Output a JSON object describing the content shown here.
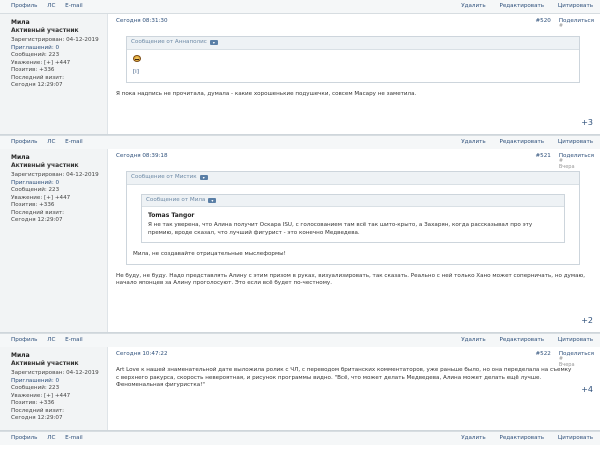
{
  "bar_top": {
    "left": [
      "Профиль",
      "ЛС",
      "E-mail"
    ],
    "right": [
      "Удалить",
      "Редактировать",
      "Цитировать"
    ]
  },
  "posts": [
    {
      "author": {
        "name": "Мила",
        "rank": "Активный участник",
        "registered": "Зарегистрирован: 04-12-2019",
        "invited": "Приглашений: 0",
        "messages": "Сообщений: 223",
        "respect": "Уважение: [+] +447",
        "positive": "Позитив: +336",
        "last_visit_label": "Последний визит:",
        "last_visit": "Сегодня 12:29:07"
      },
      "date": "Сегодня 08:31:30",
      "num": "#520",
      "share": "Поделиться",
      "share_sub": "#",
      "quote": {
        "head": "Сообщение от Аннаполис",
        "brk": "[i]"
      },
      "text": "Я пока надпись не прочитала, думала - какие хорошенькие подушечки, совсем Масару не заметила.",
      "plus": "+3"
    },
    {
      "author": {
        "name": "Мила",
        "rank": "Активный участник",
        "registered": "Зарегистрирован: 04-12-2019",
        "invited": "Приглашений: 0",
        "messages": "Сообщений: 223",
        "respect": "Уважение: [+] +447",
        "positive": "Позитив: +336",
        "last_visit_label": "Последний визит:",
        "last_visit": "Сегодня 12:29:07"
      },
      "date": "Сегодня 08:39:18",
      "num": "#521",
      "share": "Поделиться",
      "share_sub": "#",
      "share_sub2": "Вчера",
      "quote": {
        "head": "Сообщение от Мистик",
        "inner_head": "Сообщение от Мила",
        "inner_title": "Tomas Tangor",
        "inner_text": "Я не так уверена, что Алина получит Оскара ISU, с голосованием там всё так шито-крыто, а Захарян, когда рассказывал про эту премию, вроде сказал, что лучший фигурист - это конечно Медведева.",
        "text": "Мила, не создавайте отрицательные мыслеформы!"
      },
      "text": "Не буду, не буду. Надо представлять Алину с этим призом в руках, визуализировать, так сказать. Реально с ней только Хано может соперничать, но думаю, начало японцев за Алину проголосуют. Это если всё будет по-честному.",
      "plus": "+2"
    },
    {
      "author": {
        "name": "Мила",
        "rank": "Активный участник",
        "registered": "Зарегистрирован: 04-12-2019",
        "invited": "Приглашений: 0",
        "messages": "Сообщений: 223",
        "respect": "Уважение: [+] +447",
        "positive": "Позитив: +336",
        "last_visit_label": "Последний визит:",
        "last_visit": "Сегодня 12:29:07"
      },
      "date": "Сегодня 10:47:22",
      "num": "#522",
      "share": "Поделиться",
      "share_sub": "#",
      "share_sub2": "Вчера",
      "text": "Art Love к нашей знаменательной дате выложила ролик с ЧЛ, с переводом британских комментаторов, уже раньше было, но она переделала на съемку с верхнего ракурса, скорость невероятная, и рисунок программы видно. \"Всё, что может делать Медведева, Алина может делать ещё лучше. Феноменальная фигуристка!\"",
      "plus": "+4"
    }
  ],
  "bar_between": {
    "left": [
      "Профиль",
      "ЛС",
      "E-mail"
    ],
    "right": [
      "Удалить",
      "Редактировать",
      "Цитировать"
    ]
  },
  "colors": {
    "link": "#2d4f7a",
    "panel": "#f2f4f5",
    "bar": "#f5f7f8"
  }
}
